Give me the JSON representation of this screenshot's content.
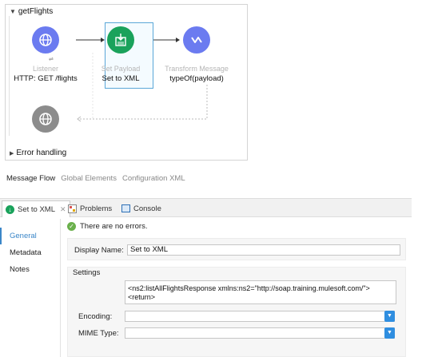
{
  "canvas": {
    "flow_name": "getFlights",
    "error_handling": "Error handling",
    "nodes": [
      {
        "type_label": "Listener",
        "name": "HTTP: GET /flights",
        "color": "#6b7bf0",
        "icon": "globe-icon"
      },
      {
        "type_label": "Set Payload",
        "name": "Set to XML",
        "color": "#1aa25b",
        "icon": "payload-icon"
      },
      {
        "type_label": "Transform Message",
        "name": "typeOf(payload)",
        "color": "#6b7bf0",
        "icon": "transform-icon"
      }
    ],
    "response_node": {
      "color": "#8c8c8c",
      "icon": "globe-icon"
    }
  },
  "view_tabs": {
    "message_flow": "Message Flow",
    "global_elements": "Global Elements",
    "configuration_xml": "Configuration XML"
  },
  "panel": {
    "tab_active": "Set to XML",
    "tab_problems": "Problems",
    "tab_console": "Console",
    "nav": [
      "General",
      "Metadata",
      "Notes"
    ],
    "status": "There are no errors.",
    "display_name_label": "Display Name:",
    "display_name_value": "Set to XML",
    "settings_label": "Settings",
    "payload_line1": "<ns2:listAllFlightsResponse xmlns:ns2=\"http://soap.training.mulesoft.com/\">",
    "payload_line2": "<return>",
    "encoding_label": "Encoding:",
    "mime_label": "MIME Type:"
  },
  "colors": {
    "accent": "#3a86c8",
    "select_blue": "#2f8ee0",
    "ok_green": "#6ab04c"
  }
}
